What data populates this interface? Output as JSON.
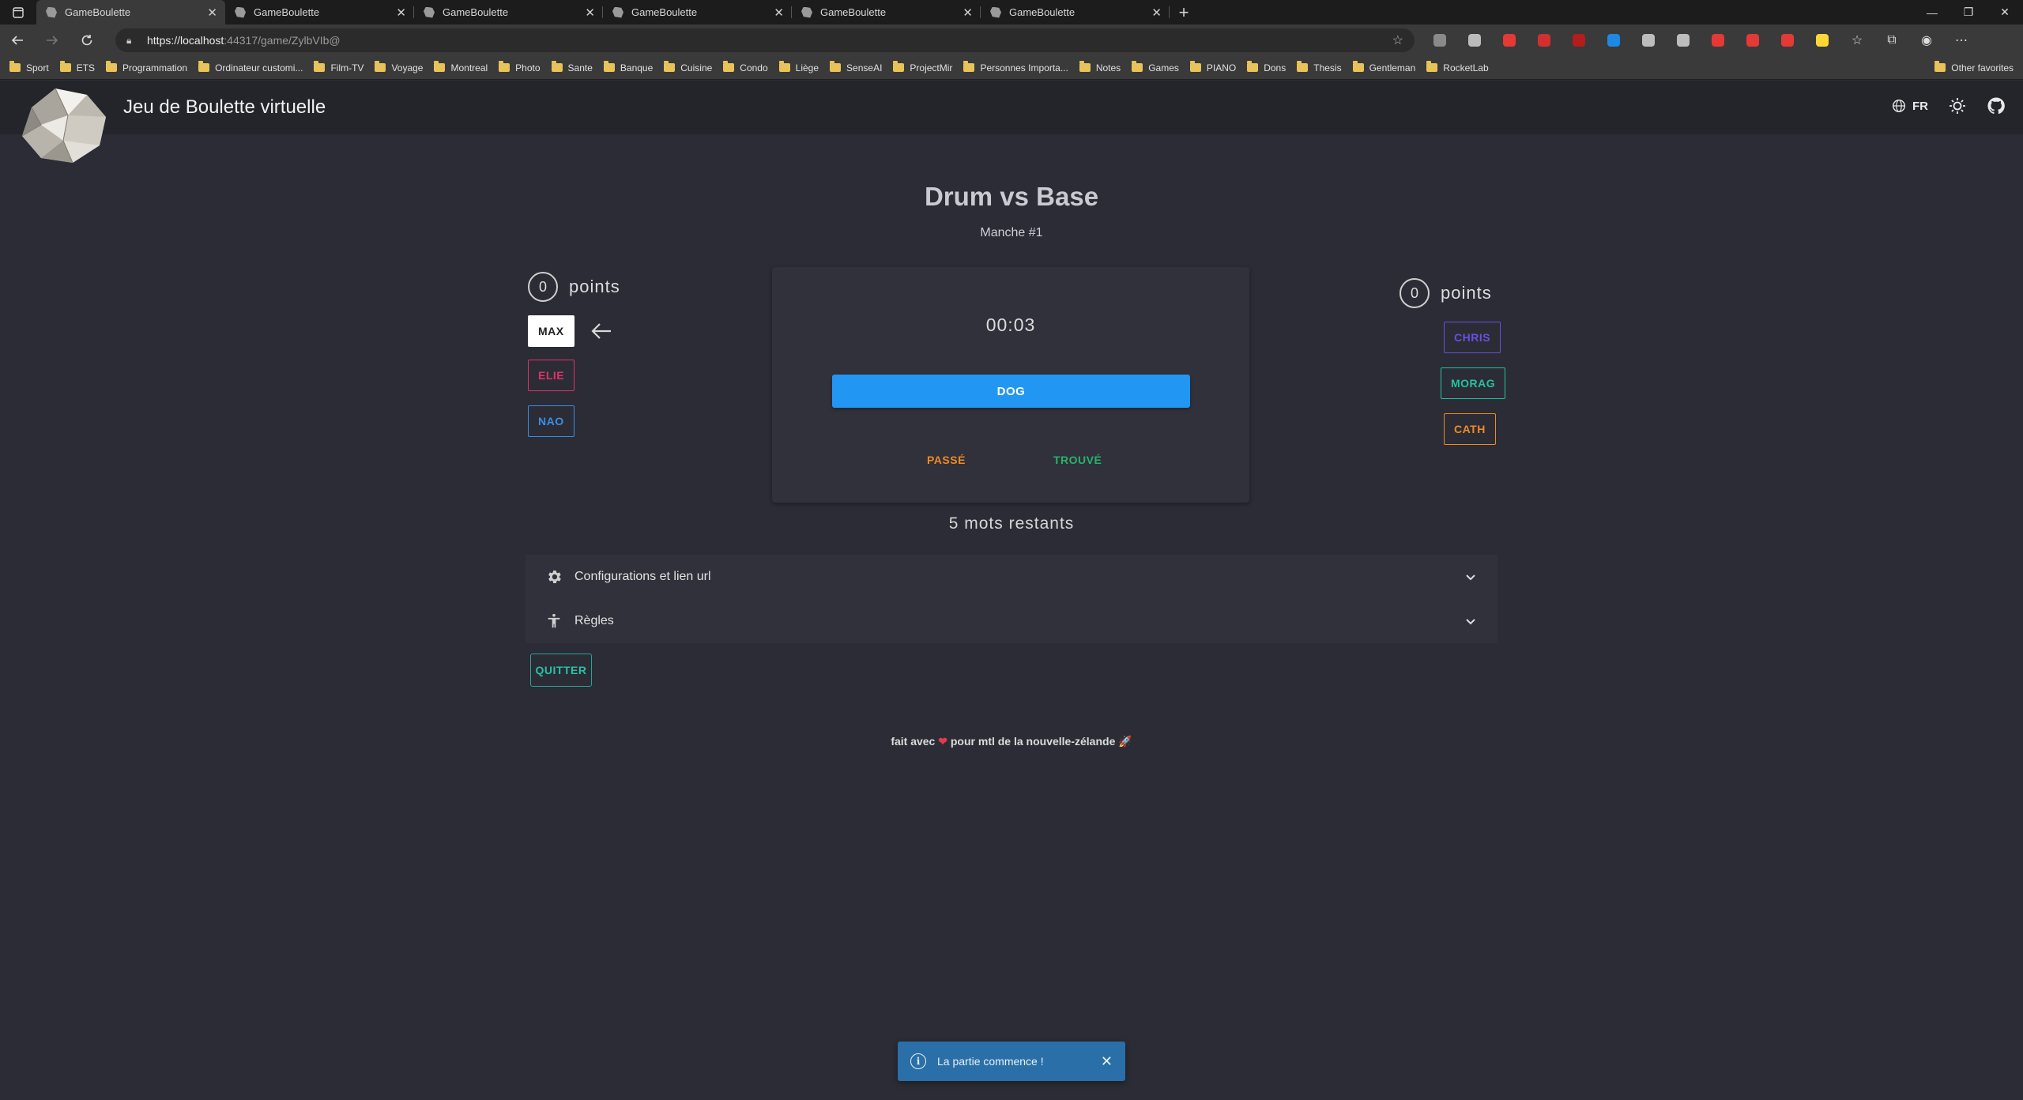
{
  "browser": {
    "tabs": [
      {
        "title": "GameBoulette",
        "active": true
      },
      {
        "title": "GameBoulette",
        "active": false
      },
      {
        "title": "GameBoulette",
        "active": false
      },
      {
        "title": "GameBoulette",
        "active": false
      },
      {
        "title": "GameBoulette",
        "active": false
      },
      {
        "title": "GameBoulette",
        "active": false
      }
    ],
    "url_host": "https://localhost",
    "url_path": ":44317/game/ZylbVIb@",
    "bookmarks": [
      "Sport",
      "ETS",
      "Programmation",
      "Ordinateur customi...",
      "Film-TV",
      "Voyage",
      "Montreal",
      "Photo",
      "Sante",
      "Banque",
      "Cuisine",
      "Condo",
      "Liège",
      "SenseAI",
      "ProjectMir",
      "Personnes Importa...",
      "Notes",
      "Games",
      "PIANO",
      "Dons",
      "Thesis",
      "Gentleman",
      "RocketLab"
    ],
    "other_favorites": "Other favorites",
    "extension_colors": [
      "#8a8a8a",
      "#bbbbbb",
      "#e53935",
      "#d32f2f",
      "#b71c1c",
      "#1e88e5",
      "#bdbdbd",
      "#bdbdbd",
      "#e53935",
      "#e53935",
      "#e53935",
      "#fdd835"
    ]
  },
  "app": {
    "title": "Jeu de Boulette virtuelle",
    "lang": "FR"
  },
  "game": {
    "title": "Drum vs Base",
    "round": "Manche #1",
    "left_team": {
      "score": "0",
      "points_label": "points",
      "players": [
        {
          "name": "MAX",
          "color": "#ffffff",
          "active": true
        },
        {
          "name": "ELIE",
          "color": "#e0336b"
        },
        {
          "name": "NAO",
          "color": "#3d8ee6"
        }
      ]
    },
    "right_team": {
      "score": "0",
      "points_label": "points",
      "players": [
        {
          "name": "CHRIS",
          "color": "#6a4fe0"
        },
        {
          "name": "MORAG",
          "color": "#26c2a0"
        },
        {
          "name": "CATH",
          "color": "#f08a24"
        }
      ]
    },
    "timer": "00:03",
    "word": "DOG",
    "pass_label": "PASSÉ",
    "found_label": "TROUVÉ",
    "remaining": "5 mots restants"
  },
  "accordions": [
    {
      "label": "Configurations et lien url"
    },
    {
      "label": "Règles"
    }
  ],
  "quit_label": "QUITTER",
  "footer": {
    "before": "fait avec",
    "heart": "❤",
    "after": "pour mtl de la nouvelle-zélande",
    "rocket": "🚀"
  },
  "toast": {
    "message": "La partie commence !"
  },
  "colors": {
    "background": "#2b2c35",
    "header": "#24252b",
    "card": "#30313a",
    "primary": "#2196f3",
    "pass": "#f08a24",
    "found": "#26b36b",
    "quit": "#26a69a",
    "toast": "#2a6fa8"
  }
}
